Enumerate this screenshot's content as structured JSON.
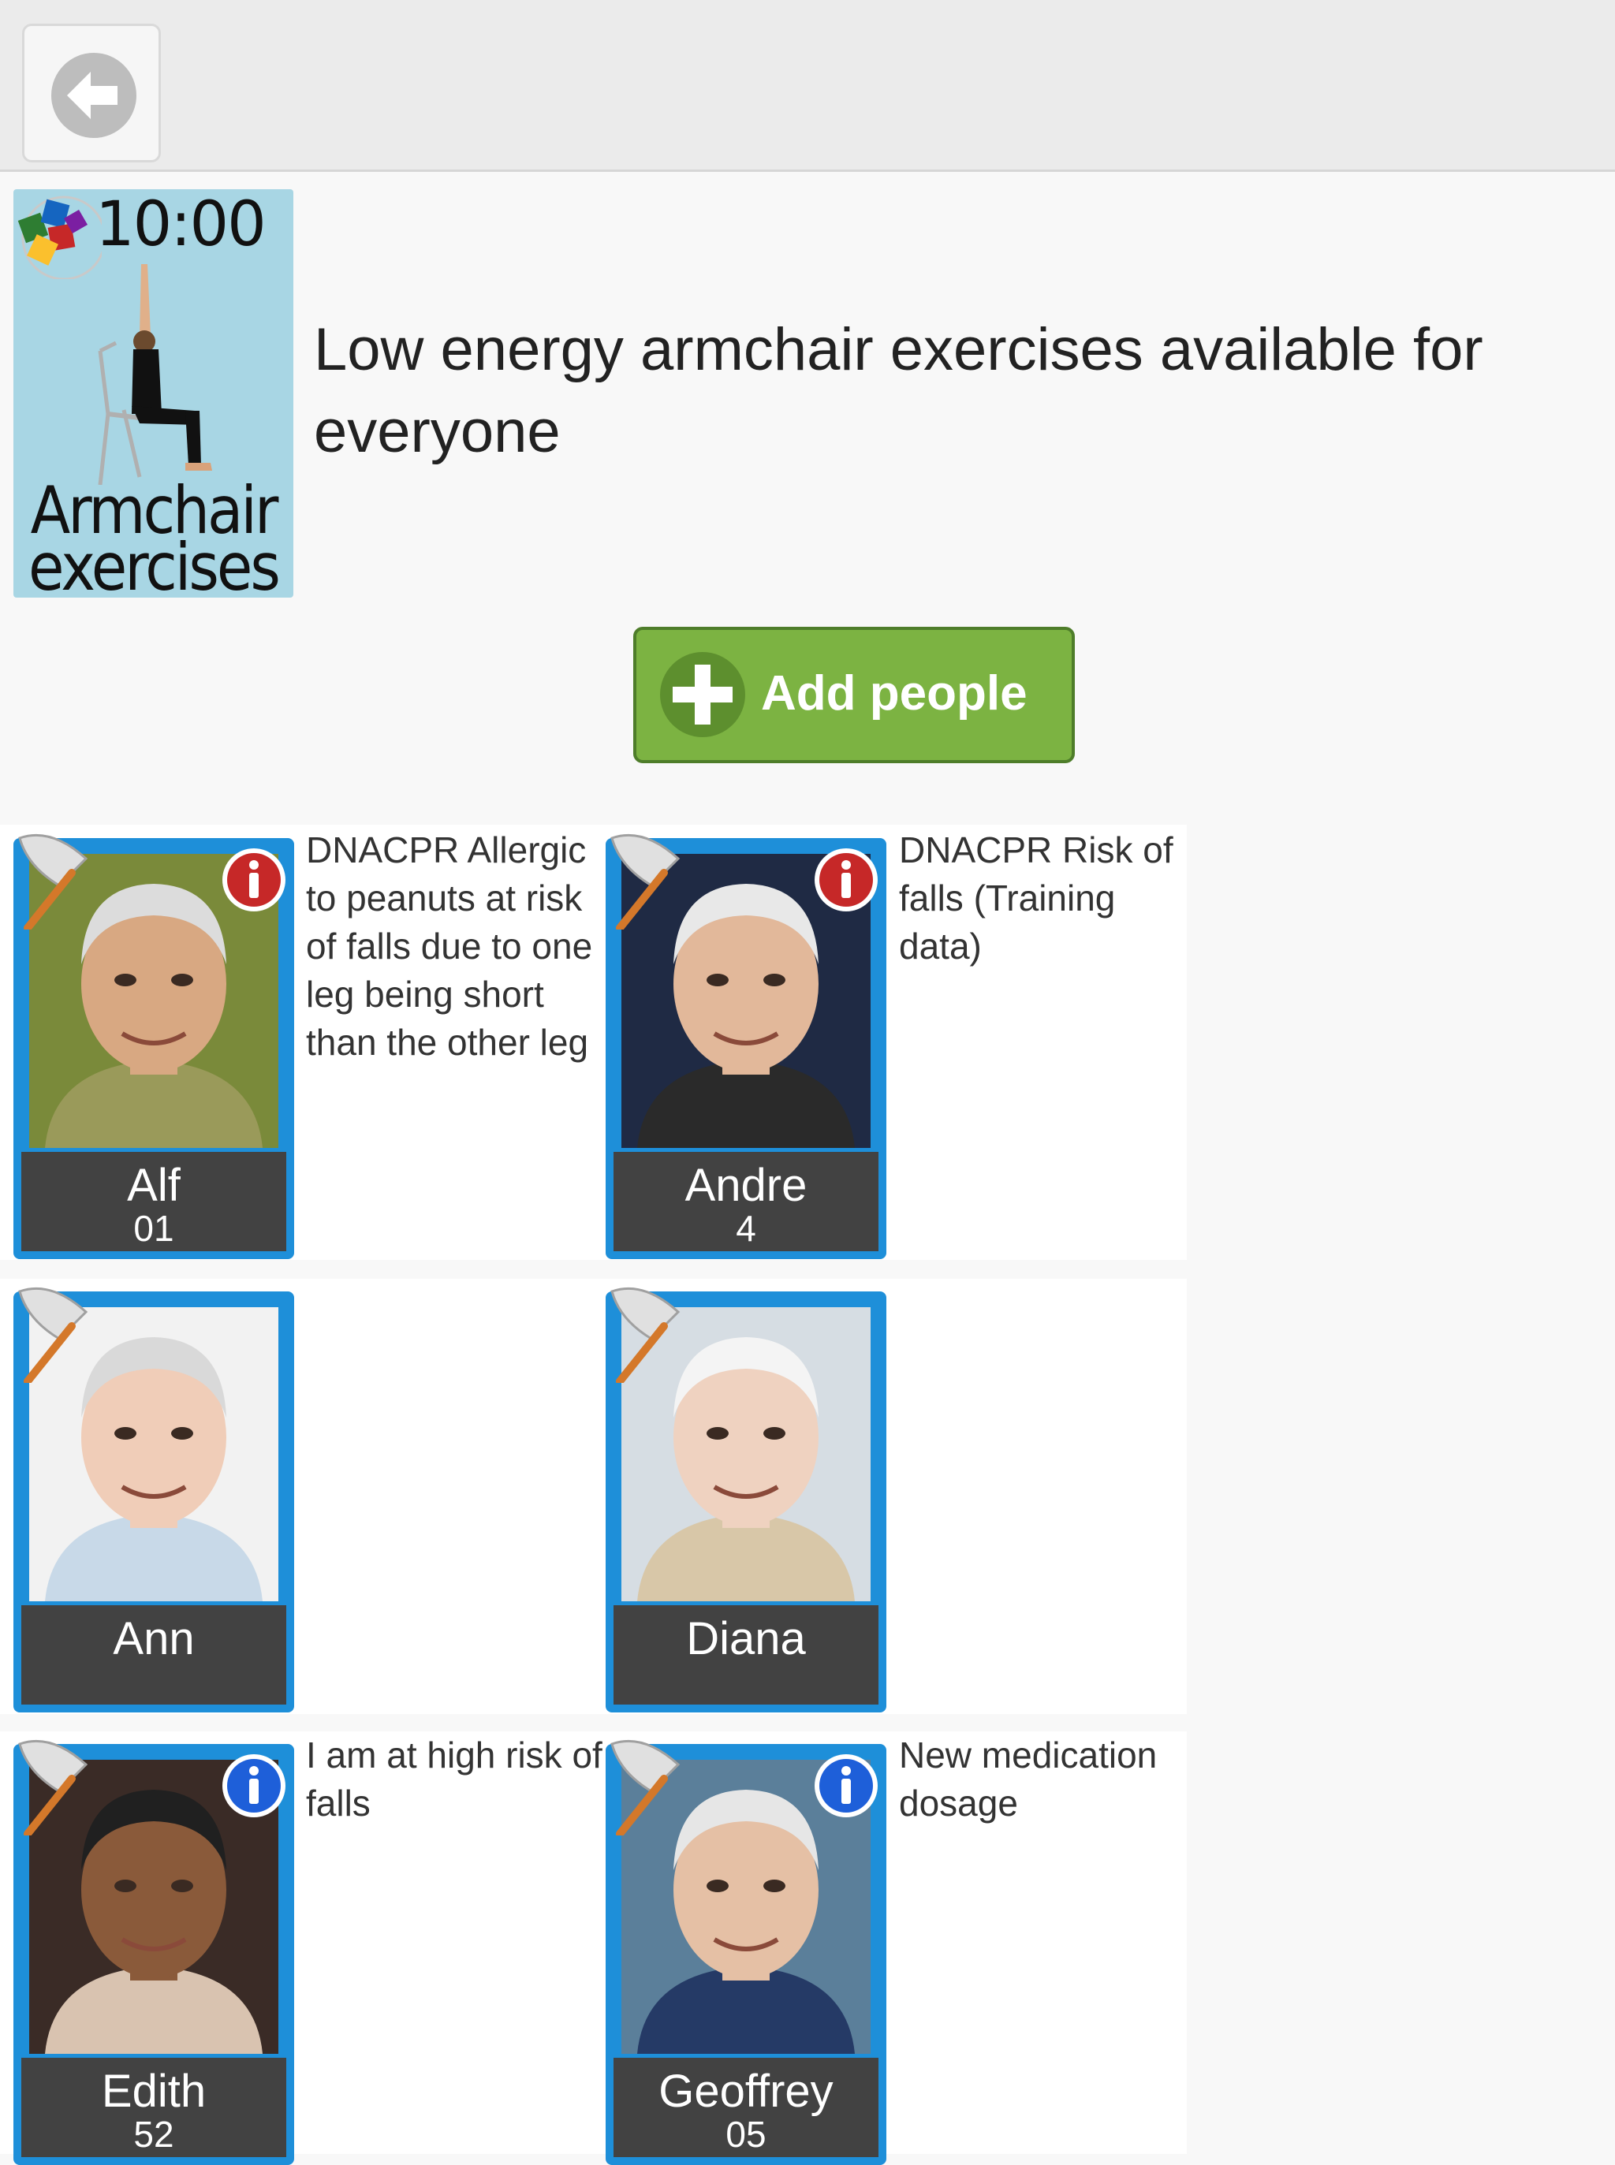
{
  "toolbar": {
    "back_icon": "back-arrow-icon"
  },
  "activity": {
    "time": "10:00",
    "tile_label": "Armchair exercises",
    "description": "Low energy armchair exercises available for everyone",
    "tile_color": "#a8d6e4"
  },
  "add_button": {
    "label": "Add people",
    "icon": "plus-circle-icon",
    "color": "#7cb342"
  },
  "people": [
    {
      "name": "Alf",
      "number": "01",
      "note": "DNACPR Allergic to peanuts at risk of falls due to one leg being short than the other leg",
      "info": "red"
    },
    {
      "name": "Andre",
      "number": "4",
      "note": "DNACPR Risk of falls (Training data)",
      "info": "red"
    },
    {
      "name": "Ann",
      "number": "",
      "note": "",
      "info": ""
    },
    {
      "name": "Diana",
      "number": "",
      "note": "",
      "info": ""
    },
    {
      "name": "Edith",
      "number": "52",
      "note": "I am at high risk of falls",
      "info": "blue"
    },
    {
      "name": "Geoffrey",
      "number": "05",
      "note": "New medication dosage",
      "info": "blue"
    }
  ],
  "colors": {
    "card_border": "#1e8fd9",
    "nameplate": "#424242",
    "info_red": "#c62828",
    "info_blue": "#1e5fd9"
  }
}
